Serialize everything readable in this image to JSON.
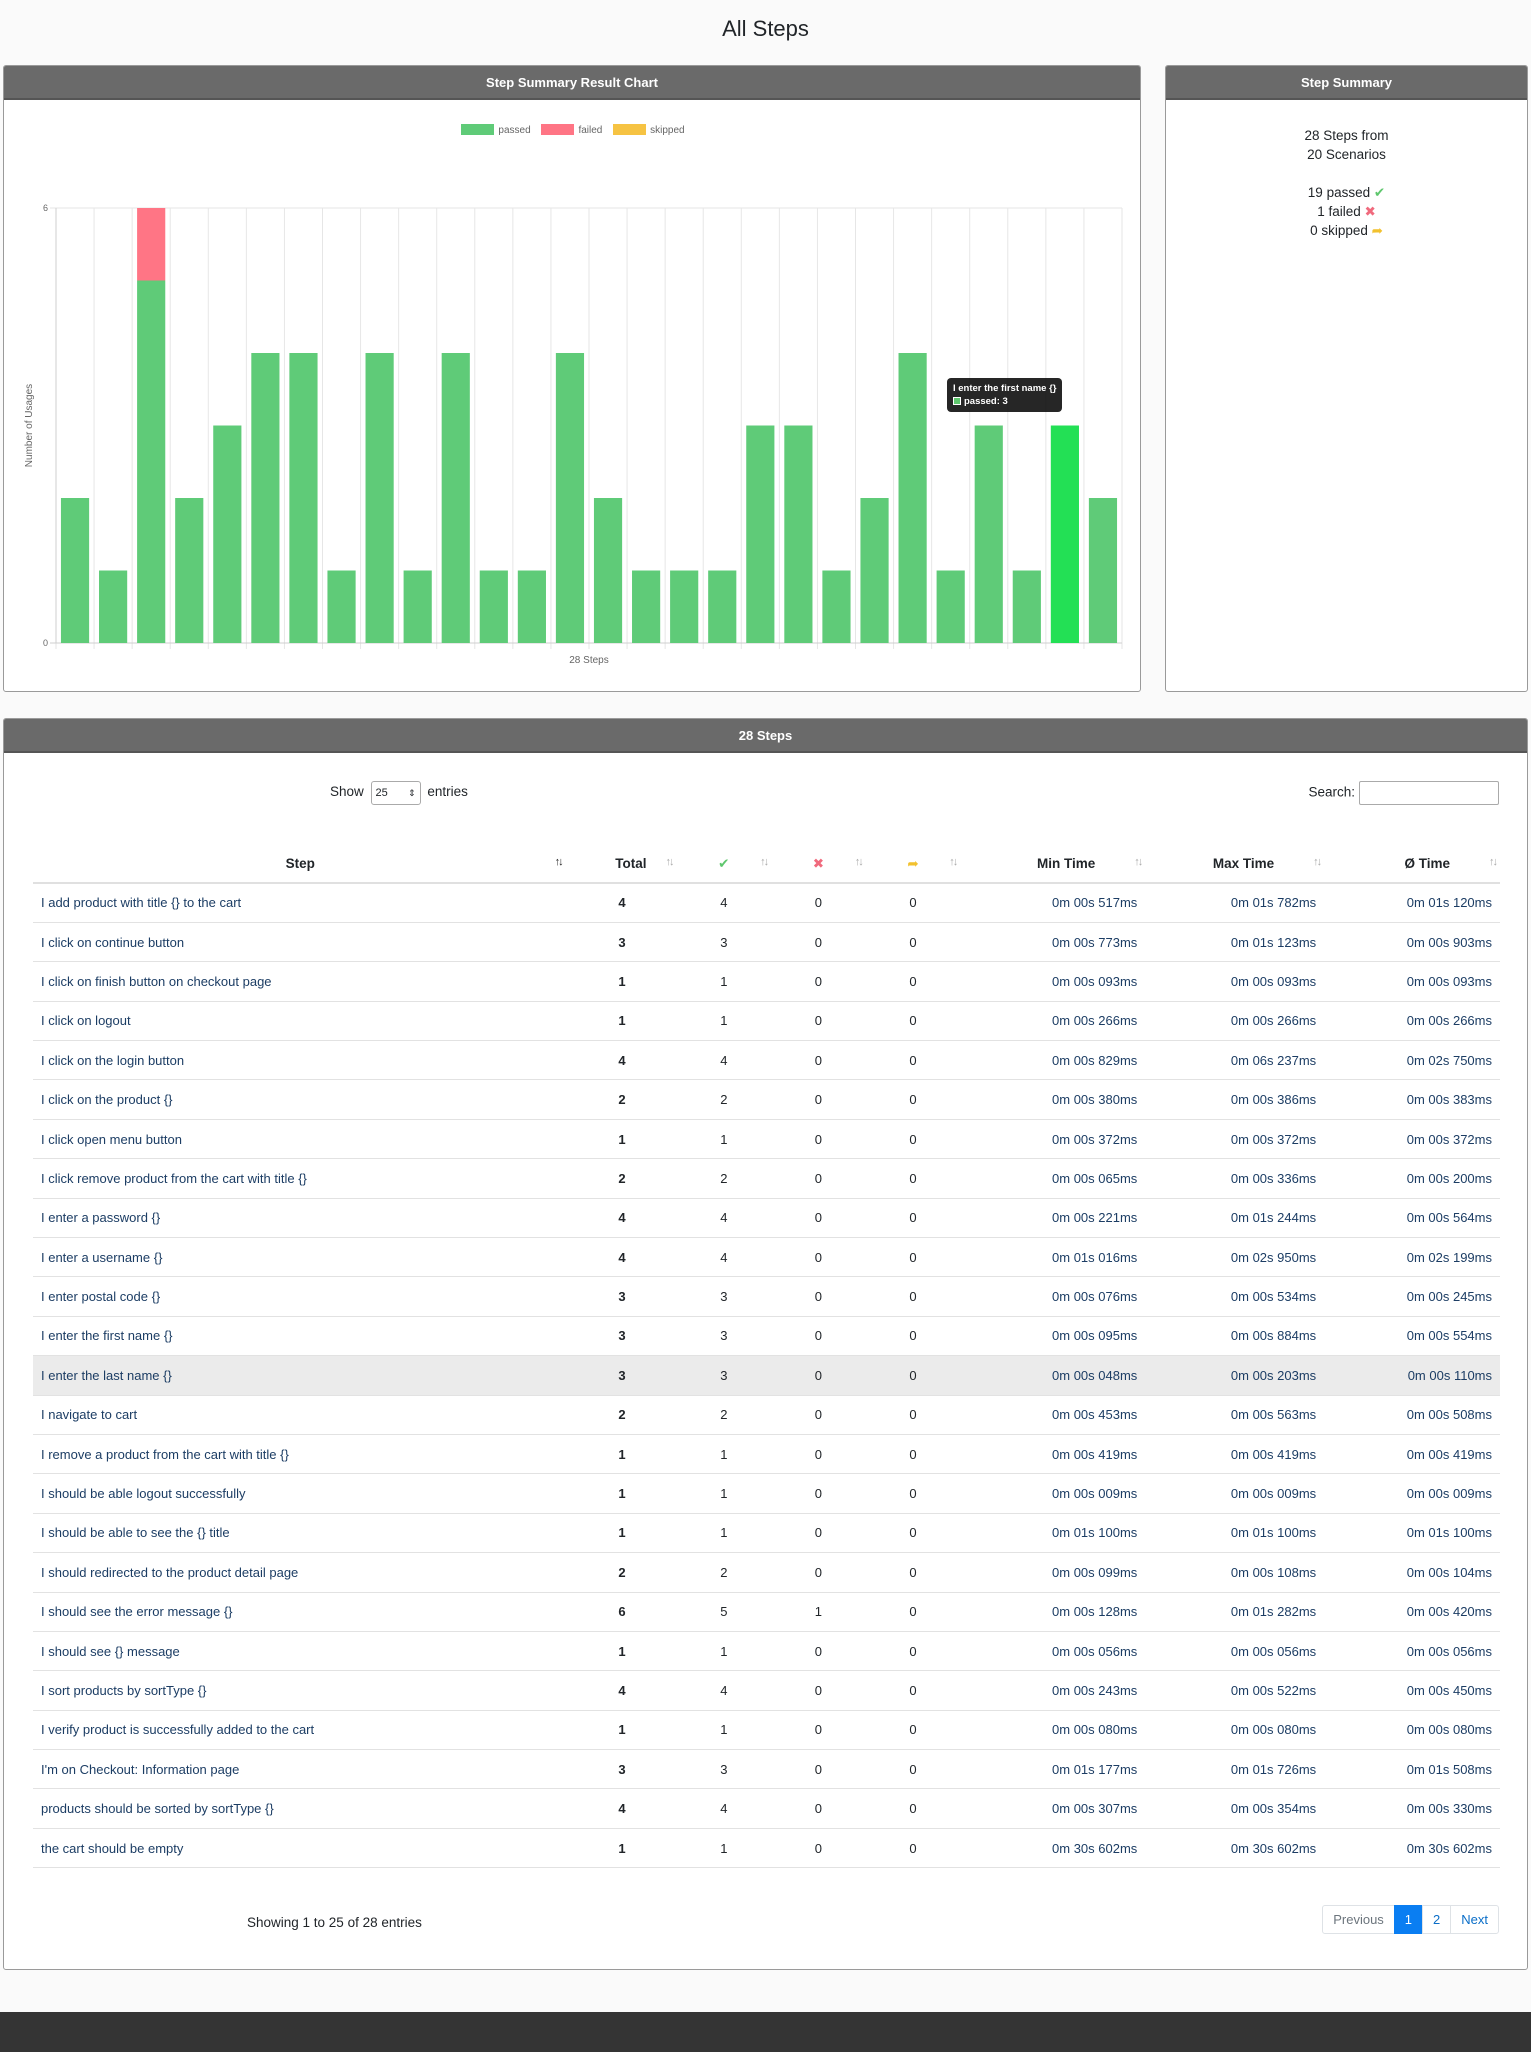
{
  "page_title": "All Steps",
  "chart_card": {
    "title": "Step Summary Result Chart",
    "tooltip_title": "I enter the first name {}",
    "tooltip_value": "passed: 3"
  },
  "colors": {
    "passed": "#5fcb78",
    "failed": "#ff7585",
    "skipped": "#f6c343",
    "highlight": "#23e055"
  },
  "chart_data": {
    "type": "bar",
    "stacked": true,
    "xlabel": "28 Steps",
    "ylabel": "Number of Usages",
    "ylim": [
      0,
      6
    ],
    "y_ticks": [
      "0",
      "6"
    ],
    "grid": true,
    "legend": "top-center",
    "categories": [
      "I add product with title {} to the cart",
      "I click on continue button",
      "I should see the error message {}",
      "I click on finish button on checkout page",
      "I enter postal code {}",
      "I click on the login button",
      "I enter a password {}",
      "I click on logout",
      "I enter a username {}",
      "I click open menu button",
      "I sort products by sortType {}",
      "I should be able logout successfully",
      "I should be able to see the {} title",
      "products should be sorted by sortType {}",
      "I enter the last name {}",
      "I remove a product from the cart with title {}",
      "I verify product is successfully added to the cart",
      "I should see {} message",
      "I'm on Checkout: Information page",
      "I enter the first name {}",
      "I click on the product {}",
      "I navigate to cart",
      "I click remove product from the cart with title {}",
      "I add product with title {} to the cart",
      "I should redirected to the product detail page",
      "I enter the first name {}",
      "I click on finish button on checkout page",
      "I enter the last name {}"
    ],
    "series": [
      {
        "name": "passed",
        "values": [
          2,
          1,
          5,
          2,
          3,
          4,
          4,
          1,
          4,
          1,
          4,
          1,
          1,
          4,
          2,
          1,
          1,
          1,
          3,
          3,
          1,
          2,
          4,
          1,
          3,
          1,
          3,
          2
        ]
      },
      {
        "name": "failed",
        "values": [
          0,
          0,
          1,
          0,
          0,
          0,
          0,
          0,
          0,
          0,
          0,
          0,
          0,
          0,
          0,
          0,
          0,
          0,
          0,
          0,
          0,
          0,
          0,
          0,
          0,
          0,
          0,
          0
        ]
      },
      {
        "name": "skipped",
        "values": [
          0,
          0,
          0,
          0,
          0,
          0,
          0,
          0,
          0,
          0,
          0,
          0,
          0,
          0,
          0,
          0,
          0,
          0,
          0,
          0,
          0,
          0,
          0,
          0,
          0,
          0,
          0,
          0
        ]
      }
    ],
    "highlighted_index": 26
  },
  "summary": {
    "title": "Step Summary",
    "line1": "28 Steps from",
    "line2": "20 Scenarios",
    "passed": "19 passed",
    "failed": "1 failed",
    "skipped": "0 skipped",
    "passed_icon": "check-icon",
    "failed_icon": "cross-icon",
    "skipped_icon": "share-arrow-icon"
  },
  "steps_card": {
    "title": "28 Steps",
    "show_label": "Show",
    "entries_label": "entries",
    "page_size": "25",
    "search_label": "Search:",
    "search_value": "",
    "info": "Showing 1 to 25 of 28 entries",
    "pager": {
      "previous": "Previous",
      "page1": "1",
      "page2": "2",
      "next": "Next"
    }
  },
  "table": {
    "headers": {
      "step": "Step",
      "total": "Total",
      "passed_icon": "check-icon",
      "failed_icon": "cross-icon",
      "skipped_icon": "share-arrow-icon",
      "min": "Min Time",
      "max": "Max Time",
      "avg": "Ø Time"
    },
    "rows": [
      {
        "step": "I add product with title {} to the cart",
        "total": "4",
        "passed": "4",
        "failed": "0",
        "skipped": "0",
        "min": "0m 00s 517ms",
        "max": "0m 01s 782ms",
        "avg": "0m 01s 120ms"
      },
      {
        "step": "I click on continue button",
        "total": "3",
        "passed": "3",
        "failed": "0",
        "skipped": "0",
        "min": "0m 00s 773ms",
        "max": "0m 01s 123ms",
        "avg": "0m 00s 903ms"
      },
      {
        "step": "I click on finish button on checkout page",
        "total": "1",
        "passed": "1",
        "failed": "0",
        "skipped": "0",
        "min": "0m 00s 093ms",
        "max": "0m 00s 093ms",
        "avg": "0m 00s 093ms"
      },
      {
        "step": "I click on logout",
        "total": "1",
        "passed": "1",
        "failed": "0",
        "skipped": "0",
        "min": "0m 00s 266ms",
        "max": "0m 00s 266ms",
        "avg": "0m 00s 266ms"
      },
      {
        "step": "I click on the login button",
        "total": "4",
        "passed": "4",
        "failed": "0",
        "skipped": "0",
        "min": "0m 00s 829ms",
        "max": "0m 06s 237ms",
        "avg": "0m 02s 750ms"
      },
      {
        "step": "I click on the product {}",
        "total": "2",
        "passed": "2",
        "failed": "0",
        "skipped": "0",
        "min": "0m 00s 380ms",
        "max": "0m 00s 386ms",
        "avg": "0m 00s 383ms"
      },
      {
        "step": "I click open menu button",
        "total": "1",
        "passed": "1",
        "failed": "0",
        "skipped": "0",
        "min": "0m 00s 372ms",
        "max": "0m 00s 372ms",
        "avg": "0m 00s 372ms"
      },
      {
        "step": "I click remove product from the cart with title {}",
        "total": "2",
        "passed": "2",
        "failed": "0",
        "skipped": "0",
        "min": "0m 00s 065ms",
        "max": "0m 00s 336ms",
        "avg": "0m 00s 200ms"
      },
      {
        "step": "I enter a password {}",
        "total": "4",
        "passed": "4",
        "failed": "0",
        "skipped": "0",
        "min": "0m 00s 221ms",
        "max": "0m 01s 244ms",
        "avg": "0m 00s 564ms"
      },
      {
        "step": "I enter a username {}",
        "total": "4",
        "passed": "4",
        "failed": "0",
        "skipped": "0",
        "min": "0m 01s 016ms",
        "max": "0m 02s 950ms",
        "avg": "0m 02s 199ms"
      },
      {
        "step": "I enter postal code {}",
        "total": "3",
        "passed": "3",
        "failed": "0",
        "skipped": "0",
        "min": "0m 00s 076ms",
        "max": "0m 00s 534ms",
        "avg": "0m 00s 245ms"
      },
      {
        "step": "I enter the first name {}",
        "total": "3",
        "passed": "3",
        "failed": "0",
        "skipped": "0",
        "min": "0m 00s 095ms",
        "max": "0m 00s 884ms",
        "avg": "0m 00s 554ms"
      },
      {
        "step": "I enter the last name {}",
        "total": "3",
        "passed": "3",
        "failed": "0",
        "skipped": "0",
        "min": "0m 00s 048ms",
        "max": "0m 00s 203ms",
        "avg": "0m 00s 110ms"
      },
      {
        "step": "I navigate to cart",
        "total": "2",
        "passed": "2",
        "failed": "0",
        "skipped": "0",
        "min": "0m 00s 453ms",
        "max": "0m 00s 563ms",
        "avg": "0m 00s 508ms"
      },
      {
        "step": "I remove a product from the cart with title {}",
        "total": "1",
        "passed": "1",
        "failed": "0",
        "skipped": "0",
        "min": "0m 00s 419ms",
        "max": "0m 00s 419ms",
        "avg": "0m 00s 419ms"
      },
      {
        "step": "I should be able logout successfully",
        "total": "1",
        "passed": "1",
        "failed": "0",
        "skipped": "0",
        "min": "0m 00s 009ms",
        "max": "0m 00s 009ms",
        "avg": "0m 00s 009ms"
      },
      {
        "step": "I should be able to see the {} title",
        "total": "1",
        "passed": "1",
        "failed": "0",
        "skipped": "0",
        "min": "0m 01s 100ms",
        "max": "0m 01s 100ms",
        "avg": "0m 01s 100ms"
      },
      {
        "step": "I should redirected to the product detail page",
        "total": "2",
        "passed": "2",
        "failed": "0",
        "skipped": "0",
        "min": "0m 00s 099ms",
        "max": "0m 00s 108ms",
        "avg": "0m 00s 104ms"
      },
      {
        "step": "I should see the error message {}",
        "total": "6",
        "passed": "5",
        "failed": "1",
        "skipped": "0",
        "min": "0m 00s 128ms",
        "max": "0m 01s 282ms",
        "avg": "0m 00s 420ms"
      },
      {
        "step": "I should see {} message",
        "total": "1",
        "passed": "1",
        "failed": "0",
        "skipped": "0",
        "min": "0m 00s 056ms",
        "max": "0m 00s 056ms",
        "avg": "0m 00s 056ms"
      },
      {
        "step": "I sort products by sortType {}",
        "total": "4",
        "passed": "4",
        "failed": "0",
        "skipped": "0",
        "min": "0m 00s 243ms",
        "max": "0m 00s 522ms",
        "avg": "0m 00s 450ms"
      },
      {
        "step": "I verify product is successfully added to the cart",
        "total": "1",
        "passed": "1",
        "failed": "0",
        "skipped": "0",
        "min": "0m 00s 080ms",
        "max": "0m 00s 080ms",
        "avg": "0m 00s 080ms"
      },
      {
        "step": "I'm on Checkout: Information page",
        "total": "3",
        "passed": "3",
        "failed": "0",
        "skipped": "0",
        "min": "0m 01s 177ms",
        "max": "0m 01s 726ms",
        "avg": "0m 01s 508ms"
      },
      {
        "step": "products should be sorted by sortType {}",
        "total": "4",
        "passed": "4",
        "failed": "0",
        "skipped": "0",
        "min": "0m 00s 307ms",
        "max": "0m 00s 354ms",
        "avg": "0m 00s 330ms"
      },
      {
        "step": "the cart should be empty",
        "total": "1",
        "passed": "1",
        "failed": "0",
        "skipped": "0",
        "min": "0m 30s 602ms",
        "max": "0m 30s 602ms",
        "avg": "0m 30s 602ms"
      }
    ],
    "highlighted_row": 12
  }
}
